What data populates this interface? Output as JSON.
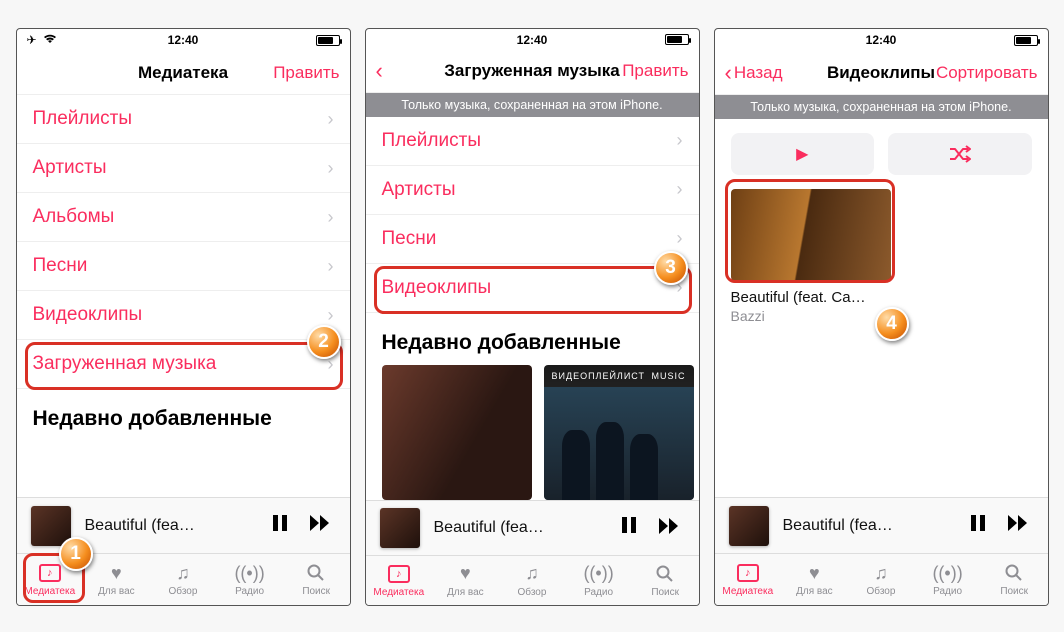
{
  "status": {
    "time": "12:40"
  },
  "colors": {
    "accent": "#fa2d5e",
    "callout": "#d93025"
  },
  "screen1": {
    "title": "Медиатека",
    "edit": "Править",
    "items": [
      "Плейлисты",
      "Артисты",
      "Альбомы",
      "Песни",
      "Видеоклипы",
      "Загруженная музыка"
    ],
    "recents_h": "Недавно добавленные"
  },
  "screen2": {
    "title": "Загруженная музыка",
    "edit": "Править",
    "banner": "Только музыка, сохраненная на этом iPhone.",
    "items": [
      "Плейлисты",
      "Артисты",
      "Песни",
      "Видеоклипы"
    ],
    "recents_h": "Недавно добавленные",
    "art2_label": "ВИДЕОПЛЕЙЛИСТ",
    "art2_brand": "MUSIC"
  },
  "screen3": {
    "back": "Назад",
    "title": "Видеоклипы",
    "sort": "Сортировать",
    "banner": "Только музыка, сохраненная на этом iPhone.",
    "play_icon": "▶",
    "shuffle_icon": "✕",
    "video": {
      "name": "Beautiful (feat. Ca…",
      "artist": "Bazzi"
    }
  },
  "mini": {
    "title": "Beautiful (fea…"
  },
  "tabs": [
    {
      "key": "library",
      "label": "Медиатека"
    },
    {
      "key": "foryou",
      "label": "Для вас"
    },
    {
      "key": "browse",
      "label": "Обзор"
    },
    {
      "key": "radio",
      "label": "Радио"
    },
    {
      "key": "search",
      "label": "Поиск"
    }
  ],
  "badges": {
    "1": "1",
    "2": "2",
    "3": "3",
    "4": "4"
  }
}
